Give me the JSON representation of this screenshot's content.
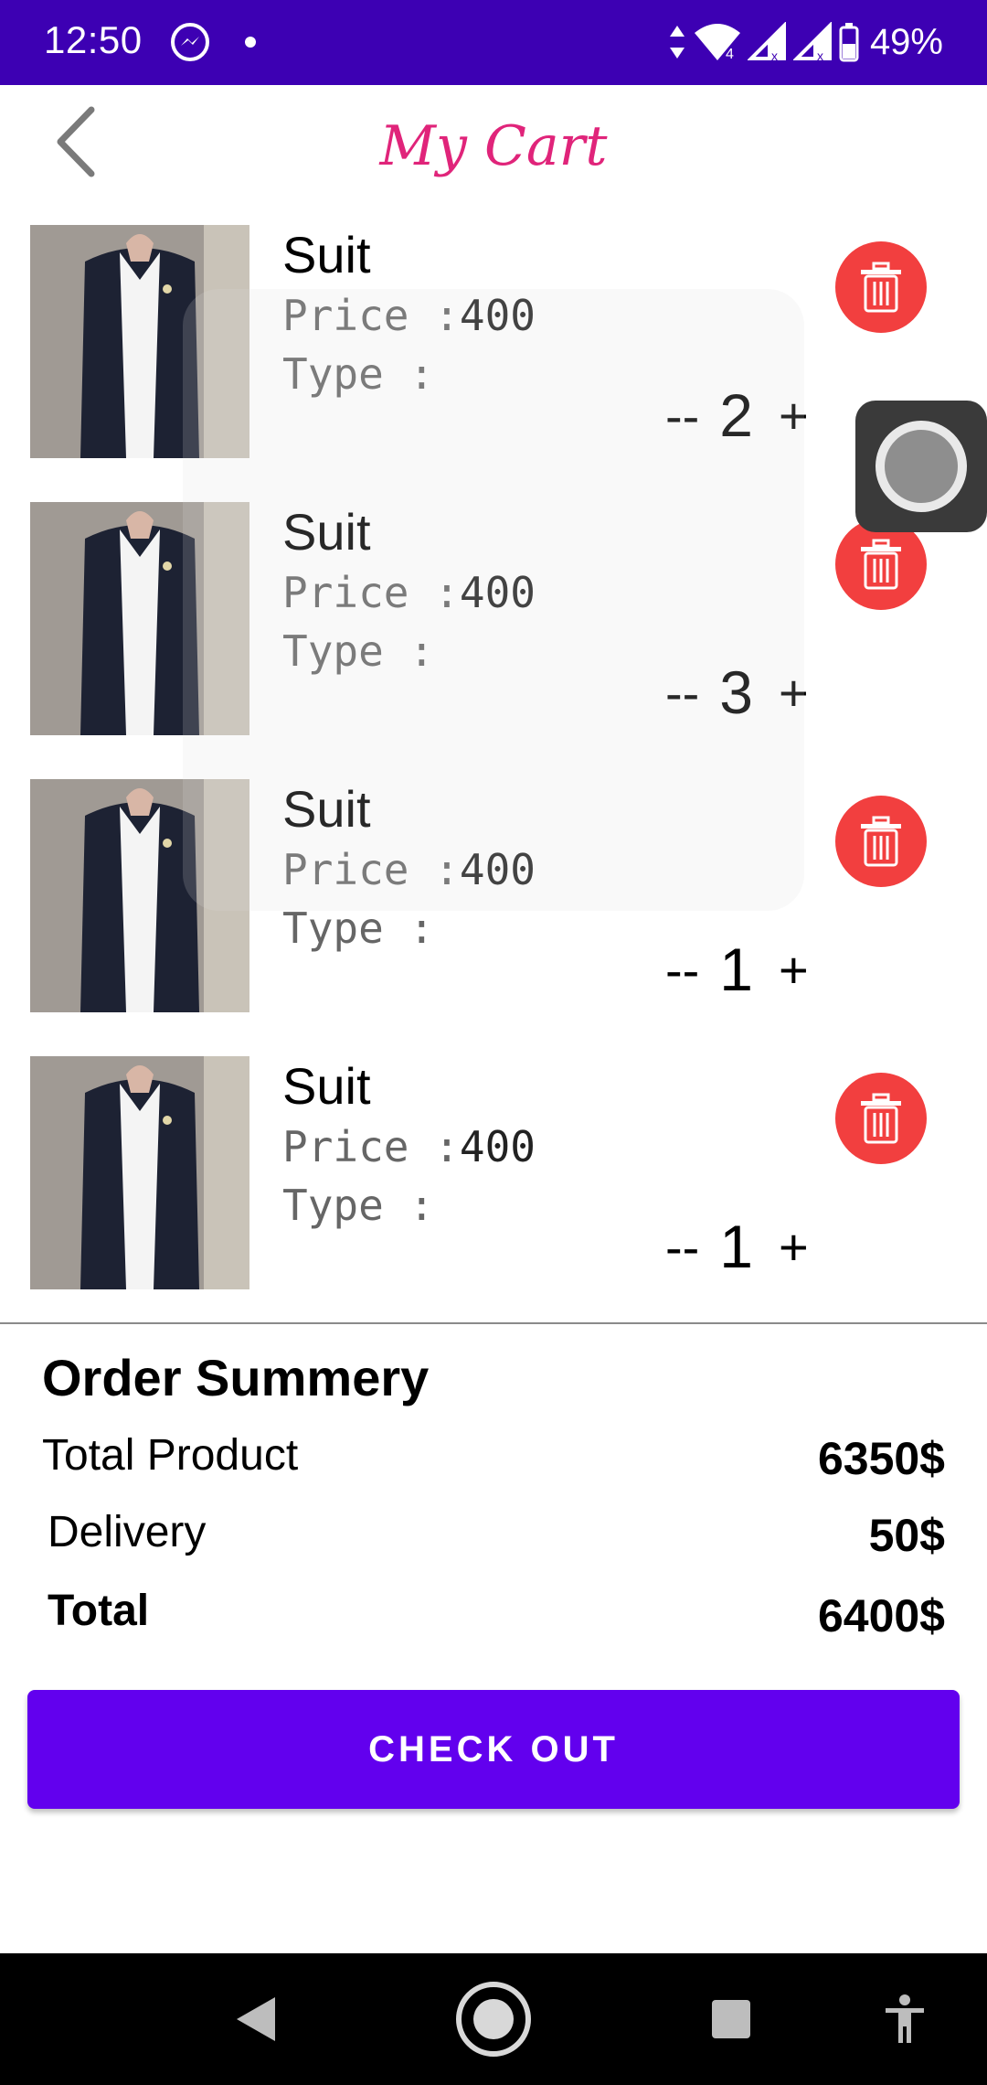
{
  "status_bar": {
    "time": "12:50",
    "battery": "49%",
    "icons": [
      "messenger-icon",
      "dot-icon",
      "data-arrows-icon",
      "wifi-icon",
      "signal-icon",
      "signal-icon",
      "battery-icon"
    ]
  },
  "header": {
    "title": "My Cart",
    "back_icon": "chevron-left-icon"
  },
  "cart": {
    "items": [
      {
        "name": "Suit",
        "price_label": "Price :",
        "price": "400",
        "type_label": "Type :",
        "qty_minus": "--",
        "quantity": "2",
        "qty_plus": "+"
      },
      {
        "name": "Suit",
        "price_label": "Price :",
        "price": "400",
        "type_label": "Type :",
        "qty_minus": "--",
        "quantity": "3",
        "qty_plus": "+"
      },
      {
        "name": "Suit",
        "price_label": "Price :",
        "price": "400",
        "type_label": "Type :",
        "qty_minus": "--",
        "quantity": "1",
        "qty_plus": "+"
      },
      {
        "name": "Suit",
        "price_label": "Price :",
        "price": "400",
        "type_label": "Type :",
        "qty_minus": "--",
        "quantity": "1",
        "qty_plus": "+"
      }
    ]
  },
  "summary": {
    "title": "Order Summery",
    "total_product_label": "Total Product",
    "total_product_value": "6350$",
    "delivery_label": "Delivery",
    "delivery_value": "50$",
    "total_label": "Total",
    "total_value": "6400$"
  },
  "checkout": {
    "label": "CHECK OUT"
  },
  "colors": {
    "status_bar": "#3d00b3",
    "title": "#e0247a",
    "delete": "#f23f3f",
    "checkout": "#6200ee"
  },
  "nav_bar": {
    "icons": [
      "back-triangle-icon",
      "home-circle-icon",
      "recents-square-icon",
      "accessibility-icon"
    ]
  }
}
